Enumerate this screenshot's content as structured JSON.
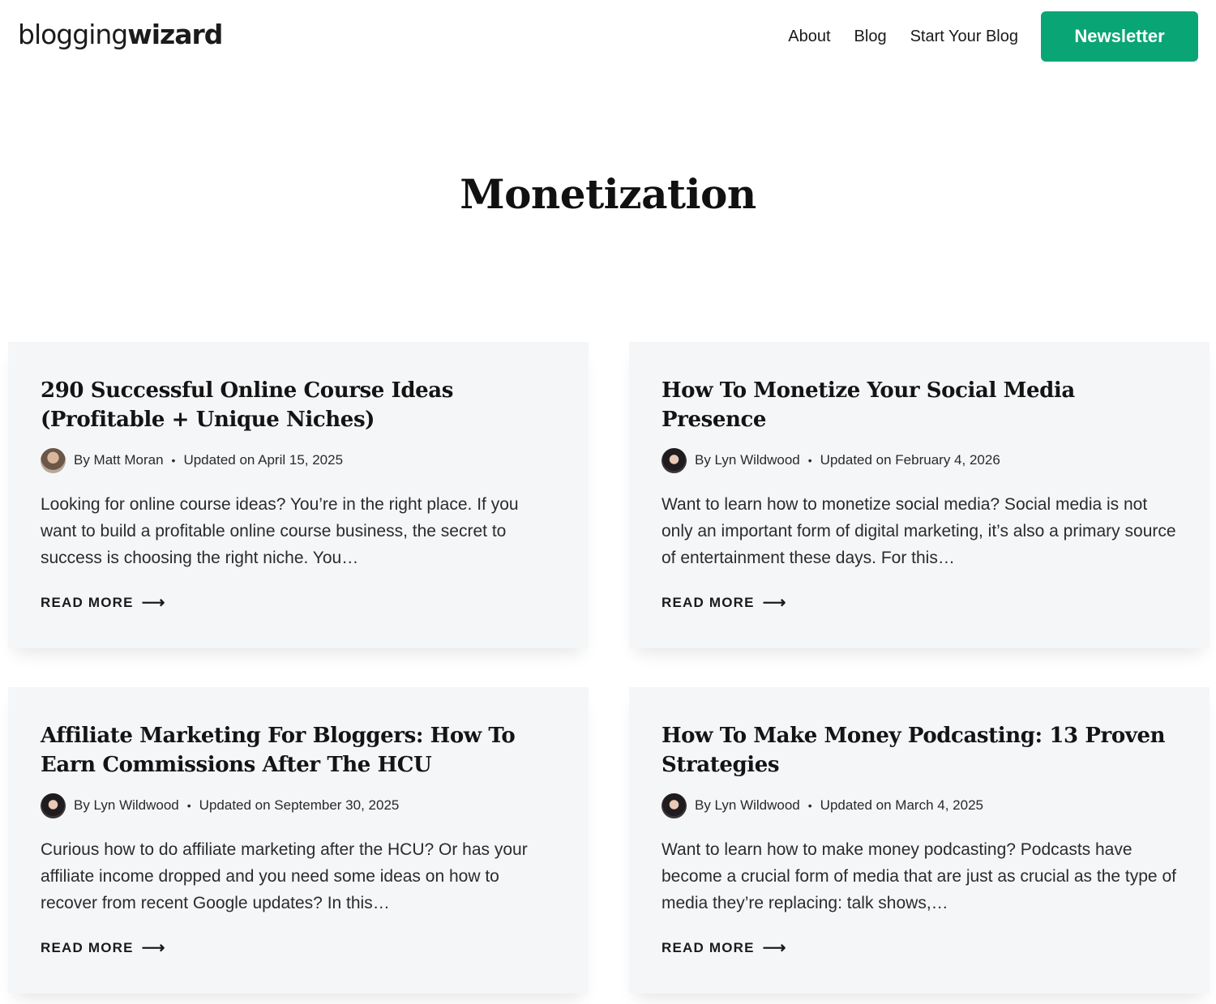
{
  "header": {
    "logo_light": "blogging",
    "logo_bold": "wizard",
    "nav": {
      "about": "About",
      "blog": "Blog",
      "start_blog": "Start Your Blog",
      "newsletter": "Newsletter"
    }
  },
  "page": {
    "title": "Monetization"
  },
  "colors": {
    "accent": "#0aa574",
    "card_background": "#f5f6f8"
  },
  "posts": [
    {
      "title": "290 Successful Online Course Ideas (Profitable + Unique Niches)",
      "author": "By Matt Moran",
      "separator": "•",
      "updated": "Updated on April 15, 2025",
      "excerpt": "Looking for online course ideas? You’re in the right place. If you want to build a profitable online course business, the secret to success is choosing the right niche.  You…",
      "read_more": "READ MORE",
      "arrow": "⟶"
    },
    {
      "title": "How To Monetize Your Social Media Presence",
      "author": "By Lyn Wildwood",
      "separator": "•",
      "updated": "Updated on February 4, 2026",
      "excerpt": "Want to learn how to monetize social media? Social media is not only an important form of digital marketing, it’s also a primary source of entertainment these days. For this…",
      "read_more": "READ MORE",
      "arrow": "⟶"
    },
    {
      "title": "Affiliate Marketing For Bloggers: How To Earn Commissions After The HCU",
      "author": "By Lyn Wildwood",
      "separator": "•",
      "updated": "Updated on September 30, 2025",
      "excerpt": "Curious how to do affiliate marketing after the HCU? Or has your affiliate income dropped and you need some ideas on how to recover from recent Google updates? In this…",
      "read_more": "READ MORE",
      "arrow": "⟶"
    },
    {
      "title": "How To Make Money Podcasting: 13 Proven Strategies",
      "author": "By Lyn Wildwood",
      "separator": "•",
      "updated": "Updated on March 4, 2025",
      "excerpt": "Want to learn how to make money podcasting? Podcasts have become a crucial form of media that are just as crucial as the type of media they’re replacing: talk shows,…",
      "read_more": "READ MORE",
      "arrow": "⟶"
    }
  ]
}
